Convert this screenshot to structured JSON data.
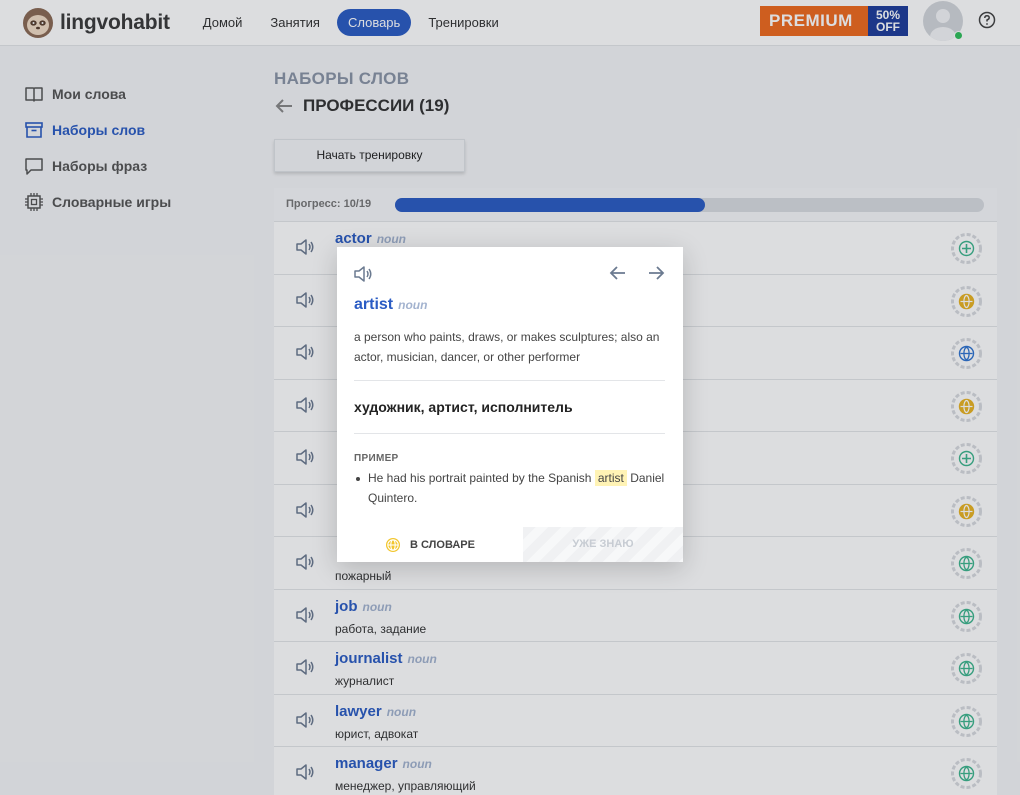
{
  "header": {
    "logo_text": "lingvohabit",
    "nav": [
      "Домой",
      "Занятия",
      "Словарь",
      "Тренировки"
    ],
    "nav_active": "Словарь",
    "premium_label": "PREMIUM",
    "discount_line1": "50%",
    "discount_line2": "OFF",
    "premium_color": "#ef6a1e",
    "discount_color": "#1e3d9a"
  },
  "sidebar": {
    "items": [
      {
        "label": "Мои слова",
        "icon": "book-icon"
      },
      {
        "label": "Наборы слов",
        "icon": "archive-box-icon"
      },
      {
        "label": "Наборы фраз",
        "icon": "speech-bubble-icon"
      },
      {
        "label": "Словарные игры",
        "icon": "chip-icon"
      }
    ],
    "active": "Наборы слов"
  },
  "main": {
    "breadcrumb": "НАБОРЫ СЛОВ",
    "title": "ПРОФЕССИИ (19)",
    "start_button": "Начать тренировку",
    "progress_label": "Прогресс: 10/19",
    "progress_fraction": 0.5263,
    "accent_color": "#2b5cc4",
    "words": [
      {
        "word": "actor",
        "pos": "noun",
        "translation": "",
        "status": "add"
      },
      {
        "word": "",
        "pos": "",
        "translation": "",
        "status": "learning"
      },
      {
        "word": "",
        "pos": "",
        "translation": "",
        "status": "learned-blue"
      },
      {
        "word": "",
        "pos": "",
        "translation": "",
        "status": "learning"
      },
      {
        "word": "",
        "pos": "",
        "translation": "",
        "status": "add"
      },
      {
        "word": "",
        "pos": "",
        "translation": "",
        "status": "learning"
      },
      {
        "word": "",
        "pos": "",
        "translation": "пожарный",
        "status": "learned"
      },
      {
        "word": "job",
        "pos": "noun",
        "translation": "работа, задание",
        "status": "learned"
      },
      {
        "word": "journalist",
        "pos": "noun",
        "translation": "журналист",
        "status": "learned"
      },
      {
        "word": "lawyer",
        "pos": "noun",
        "translation": "юрист, адвокат",
        "status": "learned"
      },
      {
        "word": "manager",
        "pos": "noun",
        "translation": "менеджер, управляющий",
        "status": "learned"
      }
    ]
  },
  "popup": {
    "word": "artist",
    "pos": "noun",
    "definition": "a person who paints, draws, or makes sculptures; also an actor, musician, dancer, or other performer",
    "translation": "художник, артист, исполнитель",
    "example_heading": "ПРИМЕР",
    "example_before": "He had his portrait painted by the Spanish",
    "example_highlight": "artist",
    "example_after": "Daniel Quintero.",
    "in_dict_button": "В СЛОВАРЕ",
    "know_button": "УЖЕ ЗНАЮ"
  }
}
